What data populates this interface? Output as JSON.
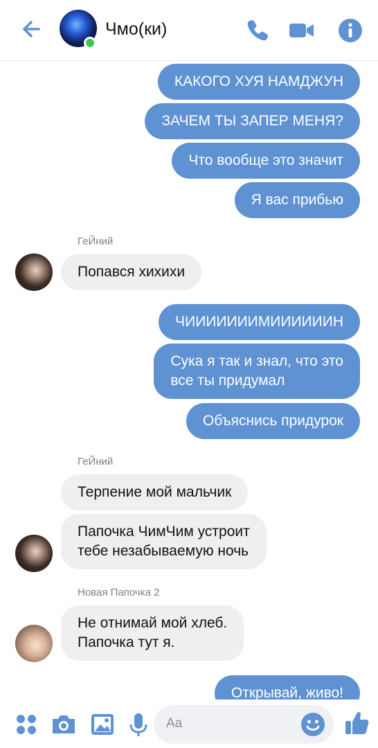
{
  "header": {
    "title": "Чмо(ки)",
    "online": true
  },
  "colors": {
    "accent": "#5e92d3",
    "outgoing_bubble": "#5e92d3",
    "incoming_bubble": "#efeff1",
    "online": "#44c552"
  },
  "messages": [
    {
      "side": "out",
      "text": "КАКОГО ХУЯ НАМДЖУН"
    },
    {
      "side": "out",
      "text": "ЗАЧЕМ ТЫ ЗАПЕР МЕНЯ?"
    },
    {
      "side": "out",
      "text": "Что вообще это значит"
    },
    {
      "side": "out",
      "text": "Я вас прибью"
    },
    {
      "side": "in",
      "sender": "ГеЙний",
      "text": "Попався хихихи"
    },
    {
      "side": "out",
      "text": "ЧИИИИИИИМИИИИИИН"
    },
    {
      "side": "out",
      "lines": [
        "Сука я так и знал, что это",
        "все ты придумал"
      ]
    },
    {
      "side": "out",
      "text": "Объяснись придурок"
    },
    {
      "side": "in",
      "sender": "ГеЙний",
      "text": "Терпение мой мальчик"
    },
    {
      "side": "in",
      "lines": [
        "Папочка ЧимЧим устроит",
        "тебе незабываемую ночь"
      ]
    },
    {
      "side": "in",
      "sender": "Новая Папочка 2",
      "lines": [
        "Не отнимай мой хлеб.",
        "Папочка тут я."
      ]
    },
    {
      "side": "out",
      "text": "Открывай, живо!"
    }
  ],
  "senders": {
    "first": "ГеЙний",
    "second": "ГеЙний",
    "third": "Новая Папочка 2"
  },
  "composer": {
    "placeholder": "Aa",
    "icons": [
      "apps-icon",
      "camera-icon",
      "image-icon",
      "microphone-icon",
      "emoji-icon",
      "like-icon"
    ]
  }
}
